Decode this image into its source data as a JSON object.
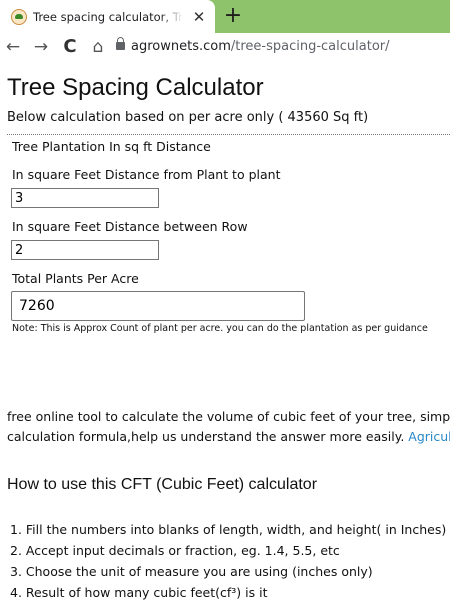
{
  "browser": {
    "tab_title": "Tree spacing calculator, Trees per acre",
    "tab_close": "✕",
    "new_tab": "+",
    "url_domain": "agrownets.com",
    "url_path": "/tree-spacing-calculator/",
    "theme_color": "#8fc36b"
  },
  "page": {
    "title": "Tree Spacing Calculator",
    "subtitle": "Below calculation based on per acre only ( 43560 Sq ft)",
    "form": {
      "heading": "Tree Plantation In sq ft Distance",
      "plant_label": "In square Feet Distance from Plant to plant",
      "plant_value": "3",
      "row_label": "In square Feet Distance between Row",
      "row_value": "2",
      "total_label": "Total Plants Per Acre",
      "total_value": "7260",
      "note": "Note: This is Approx Count of plant per acre. you can do the plantation as per guidance"
    },
    "paragraph": {
      "line1": "free online tool to calculate the volume of cubic feet of your tree, simpl",
      "line2": "calculation formula,help us understand the answer more easily. ",
      "link": "Agricult",
      "link_color": "#2a88c8"
    },
    "howto": {
      "heading": "How to use this CFT (Cubic Feet) calculator",
      "steps": [
        "1. Fill the numbers into blanks of length, width, and height( in Inches)",
        "2. Accept input decimals or fraction, eg. 1.4, 5.5, etc",
        "3. Choose the unit of measure you are using (inches only)",
        "4. Result of how many cubic feet(cf³) is it"
      ]
    }
  }
}
